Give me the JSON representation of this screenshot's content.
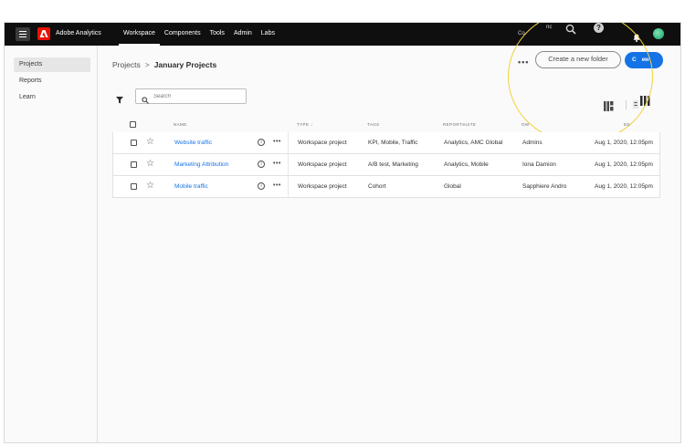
{
  "topbar": {
    "app_title": "Adobe Analytics",
    "nav": [
      "Workspace",
      "Components",
      "Tools",
      "Admin",
      "Labs"
    ],
    "right_text": "Co",
    "right_text2": "nc"
  },
  "sidebar": {
    "items": [
      {
        "label": "Projects"
      },
      {
        "label": "Reports"
      },
      {
        "label": "Learn"
      }
    ]
  },
  "breadcrumb": {
    "root": "Projects",
    "separator": ">",
    "current": "January Projects"
  },
  "toolbar": {
    "more_label": "•••",
    "create_folder_label": "Create a new folder",
    "new_label_1": "C",
    "new_label_2": "ew"
  },
  "search": {
    "placeholder": "Search"
  },
  "table": {
    "headers": {
      "name": "NAME",
      "type": "TYPE ↓",
      "tags": "TAGS",
      "reportsuite": "REPORTSUITE",
      "owner": "OW",
      "modified": "ED"
    },
    "rows": [
      {
        "name": "Website traffic",
        "type": "Workspace project",
        "tags": "KPI, Mobile, Traffic",
        "reportsuite": "Analytics, AMC Global",
        "owner": "Admins",
        "modified": "Aug 1, 2020, 12:05pm"
      },
      {
        "name": "Marketing Attribution",
        "type": "Workspace project",
        "tags": "A/B test, Marketing",
        "reportsuite": "Analytics, Mobile",
        "owner": "Iona Damion",
        "modified": "Aug 1, 2020, 12:05pm"
      },
      {
        "name": "Mobile traffic",
        "type": "Workspace project",
        "tags": "Cohort",
        "reportsuite": "Global",
        "owner": "Sapphiere Andro",
        "modified": "Aug 1, 2020, 12:05pm"
      }
    ]
  },
  "colors": {
    "accent": "#1473e6",
    "adobe_red": "#eb1000",
    "highlight_ring": "#f1d23b",
    "topbar": "#0f0f0f"
  }
}
